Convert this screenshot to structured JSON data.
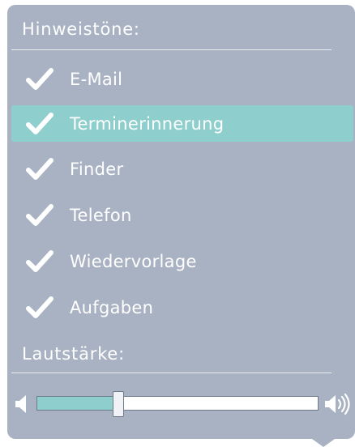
{
  "panel": {
    "sounds_heading": "Hinweistöne:",
    "volume_heading": "Lautstärke:",
    "options": [
      {
        "label": "E-Mail",
        "checked": true,
        "selected": false
      },
      {
        "label": "Terminerinnerung",
        "checked": true,
        "selected": true
      },
      {
        "label": "Finder",
        "checked": true,
        "selected": false
      },
      {
        "label": "Telefon",
        "checked": true,
        "selected": false
      },
      {
        "label": "Wiedervorlage",
        "checked": true,
        "selected": false
      },
      {
        "label": "Aufgaben",
        "checked": true,
        "selected": false
      }
    ],
    "volume": {
      "level": 0.29
    },
    "colors": {
      "panel": "#a9b2c3",
      "accent": "#8ecfcd",
      "text": "#ffffff"
    },
    "icons": {
      "check": "checkmark-icon",
      "volume_down": "speaker-low-icon",
      "volume_up": "speaker-high-icon"
    }
  }
}
